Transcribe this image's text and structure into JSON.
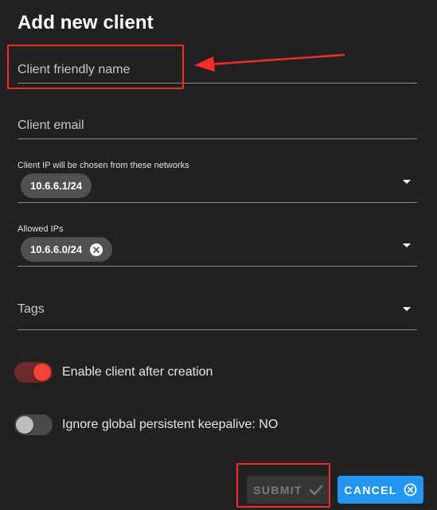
{
  "dialog": {
    "title": "Add new client"
  },
  "form": {
    "friendly_name": {
      "placeholder": "Client friendly name",
      "value": ""
    },
    "email": {
      "placeholder": "Client email",
      "value": ""
    },
    "client_ip": {
      "label": "Client IP will be chosen from these networks",
      "selected": "10.6.6.1/24"
    },
    "allowed_ips": {
      "label": "Allowed IPs",
      "selected": "10.6.6.0/24"
    },
    "tags": {
      "placeholder": "Tags"
    },
    "enable_toggle": {
      "label": "Enable client after creation",
      "on": true
    },
    "keepalive_toggle": {
      "label": "Ignore global persistent keepalive: NO",
      "on": false
    }
  },
  "actions": {
    "submit_label": "SUBMIT",
    "cancel_label": "CANCEL"
  },
  "colors": {
    "background": "#212121",
    "accent_blue": "#2196f3",
    "toggle_on": "#f44336",
    "annotation_red": "#ff2a2a"
  },
  "icons": {
    "submit": "check-icon",
    "cancel": "close-circle-icon",
    "dropdown": "caret-down-icon",
    "chip_remove": "close-circle-icon"
  }
}
